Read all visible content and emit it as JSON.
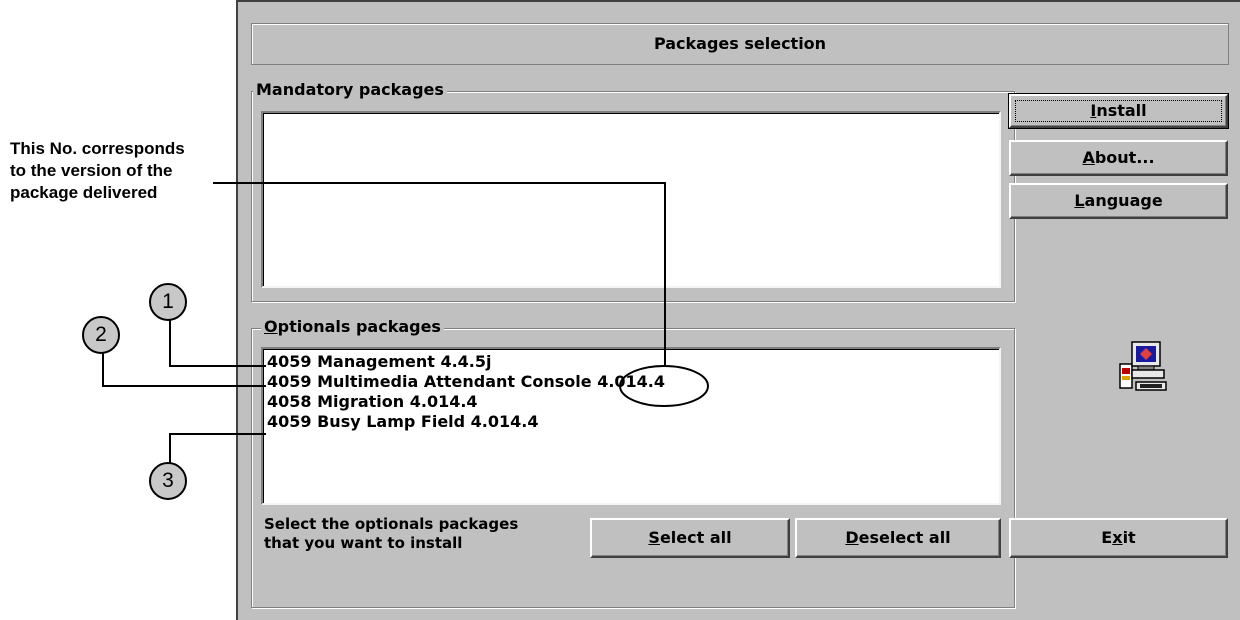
{
  "window": {
    "title": "Packages selection"
  },
  "mandatory": {
    "label": "Mandatory packages",
    "items": []
  },
  "optionals": {
    "label_first": "O",
    "label_rest": "ptionals packages",
    "items": [
      "4059 Management 4.4.5j",
      "4059 Multimedia Attendant Console 4.014.4",
      "4058 Migration 4.014.4",
      "4059 Busy Lamp Field 4.014.4"
    ]
  },
  "buttons": {
    "install": {
      "hot": "I",
      "rest": "nstall"
    },
    "about": {
      "hot": "A",
      "rest": "bout..."
    },
    "language": {
      "hot": "L",
      "rest": "anguage"
    },
    "select_all": {
      "hot": "S",
      "rest": "elect all"
    },
    "deselect_all": {
      "hot": "D",
      "rest": "eselect all"
    },
    "exit": {
      "pre": "E",
      "hot": "x",
      "rest": "it"
    }
  },
  "hint": {
    "line1": "Select the optionals packages",
    "line2": "that you want to install"
  },
  "annotation": {
    "line1": "This No. corresponds",
    "line2": "to the version of the",
    "line3": "package delivered"
  },
  "callouts": [
    "1",
    "2",
    "3"
  ],
  "icon": "setup-computer-icon"
}
